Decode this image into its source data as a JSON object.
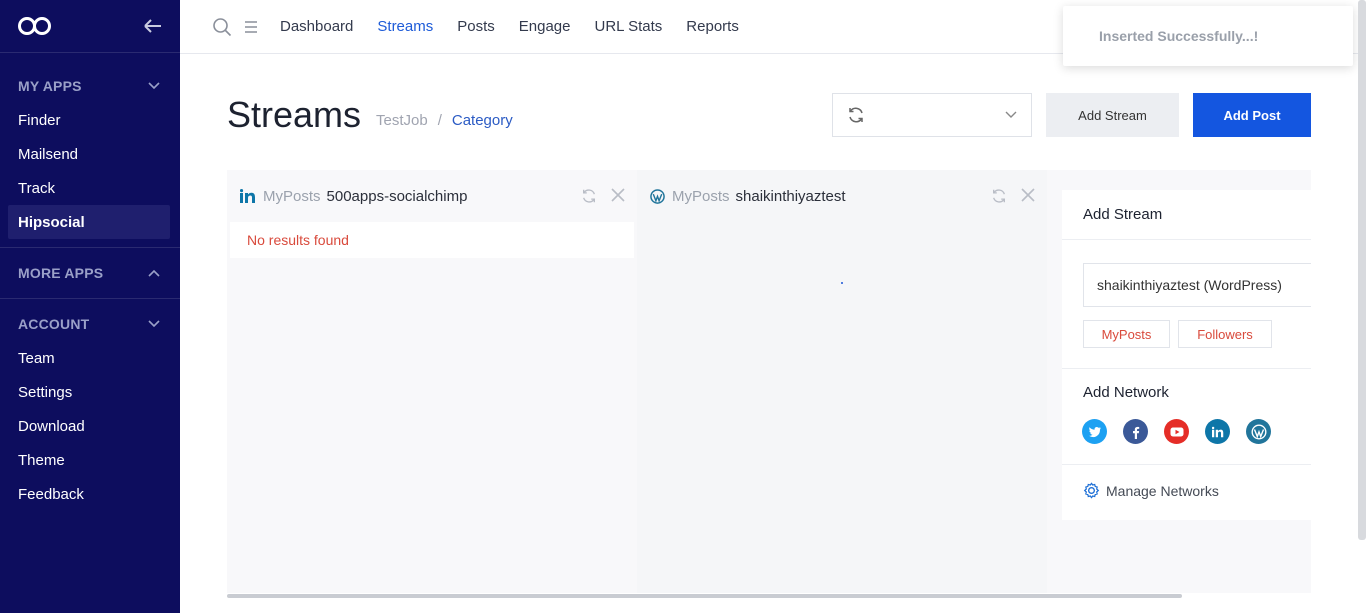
{
  "sidebar": {
    "sections": [
      {
        "title": "MY APPS",
        "items": [
          "Finder",
          "Mailsend",
          "Track",
          "Hipsocial"
        ],
        "active": "Hipsocial"
      },
      {
        "title": "MORE APPS",
        "items": []
      },
      {
        "title": "ACCOUNT",
        "items": [
          "Team",
          "Settings",
          "Download",
          "Theme",
          "Feedback"
        ]
      }
    ]
  },
  "topnav": {
    "items": [
      "Dashboard",
      "Streams",
      "Posts",
      "Engage",
      "URL Stats",
      "Reports"
    ],
    "active": "Streams"
  },
  "toast": {
    "message": "Inserted Successfully...!"
  },
  "header": {
    "title": "Streams",
    "breadcrumb": [
      "TestJob",
      "/",
      "Category"
    ],
    "add_stream_label": "Add Stream",
    "add_post_label": "Add Post"
  },
  "streams": [
    {
      "network_icon": "linkedin-icon",
      "label": "MyPosts",
      "name": "500apps-socialchimp",
      "empty_text": "No results found"
    },
    {
      "network_icon": "wordpress-icon",
      "label": "MyPosts",
      "name": "shaikinthiyaztest",
      "empty_text": ""
    }
  ],
  "panel": {
    "title": "Add Stream",
    "account": "shaikinthiyaztest (WordPress)",
    "tags": [
      "MyPosts",
      "Followers"
    ],
    "network_title": "Add Network",
    "networks": [
      {
        "name": "twitter-icon",
        "color": "#1da1f2"
      },
      {
        "name": "facebook-icon",
        "color": "#3b5998"
      },
      {
        "name": "youtube-icon",
        "color": "#e52d27"
      },
      {
        "name": "linkedin-icon",
        "color": "#0e76a8"
      },
      {
        "name": "wordpress-icon",
        "color": "#21759b"
      }
    ],
    "manage_label": "Manage Networks"
  },
  "colors": {
    "sidebar": "#0d0d5e",
    "accent": "#1456e0",
    "error": "#d94a3c"
  }
}
